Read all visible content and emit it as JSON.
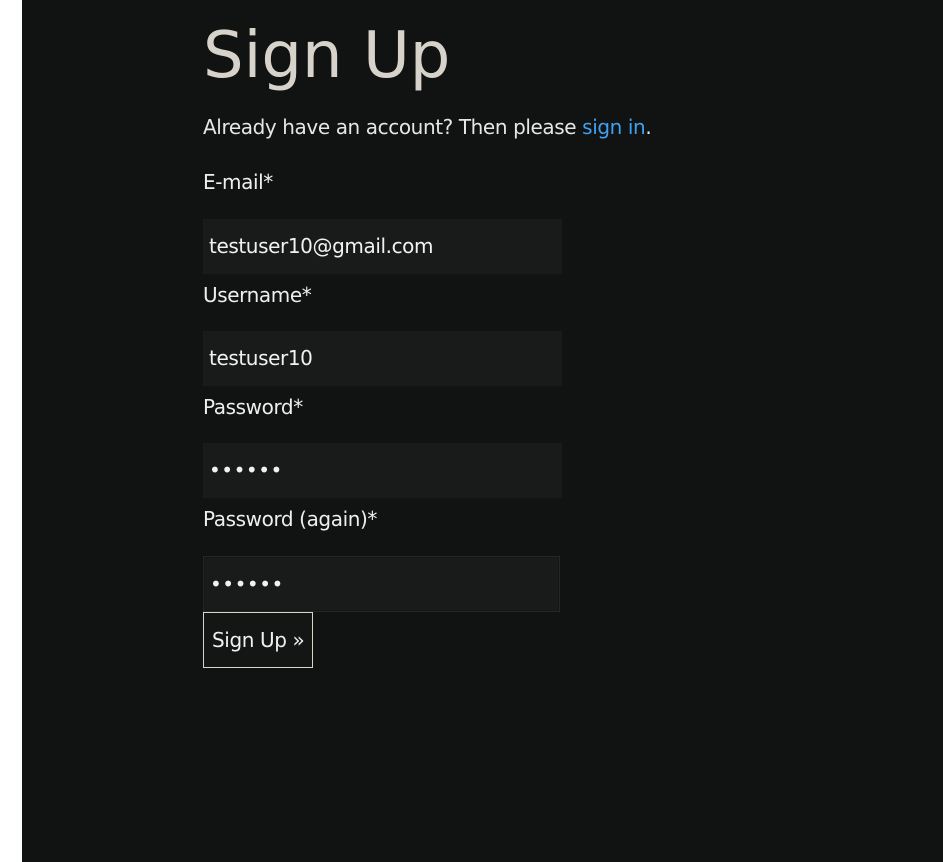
{
  "page": {
    "title": "Sign Up",
    "intro_text": "Already have an account? Then please ",
    "sign_in_link": "sign in",
    "intro_suffix": "."
  },
  "form": {
    "email": {
      "label": "E-mail*",
      "value": "testuser10@gmail.com"
    },
    "username": {
      "label": "Username*",
      "value": "testuser10"
    },
    "password": {
      "label": "Password*",
      "value": "••••••"
    },
    "password_again": {
      "label": "Password (again)*",
      "value": "••••••"
    },
    "submit_label": "Sign Up »"
  },
  "colors": {
    "background": "#111212",
    "title": "#d8d3ca",
    "text": "#eeeeee",
    "link": "#3fa0f0",
    "input_background": "#191a1a",
    "button_border": "#d9d4c8"
  }
}
